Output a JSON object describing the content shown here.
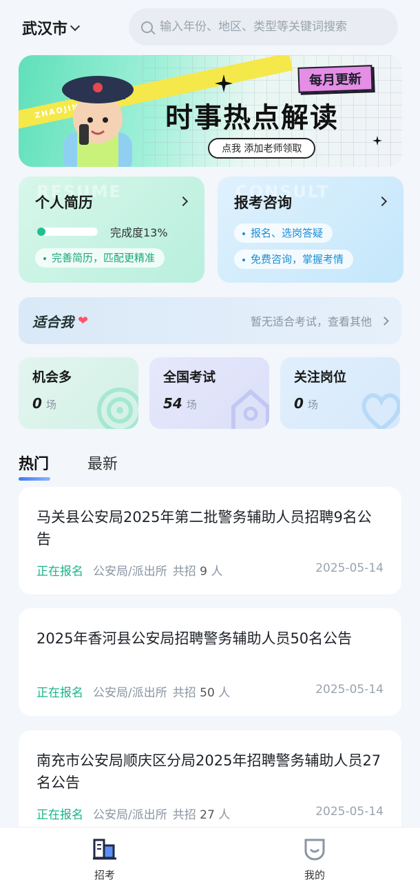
{
  "header": {
    "city": "武汉市",
    "search_placeholder": "输入年份、地区、类型等关键词搜索"
  },
  "banner": {
    "badge": "每月更新",
    "headline": "时事热点解读",
    "cta": "点我 添加老师领取",
    "stripe_text": "ZHAOJING KAO"
  },
  "resume_card": {
    "ghost": "RESUME",
    "title": "个人简历",
    "progress_label": "完成度13%",
    "progress": 0.13,
    "tip": "完善简历，匹配更精准"
  },
  "consult_card": {
    "ghost": "CONSULT",
    "title": "报考咨询",
    "tips": [
      "报名、选岗答疑",
      "免费咨询，掌握考情"
    ]
  },
  "suit": {
    "label": "适合我",
    "hint": "暂无适合考试，查看其他"
  },
  "stats": [
    {
      "name": "机会多",
      "value": "0",
      "unit": "场"
    },
    {
      "name": "全国考试",
      "value": "54",
      "unit": "场"
    },
    {
      "name": "关注岗位",
      "value": "0",
      "unit": "场"
    }
  ],
  "tabs": [
    "热门",
    "最新"
  ],
  "jobs": [
    {
      "title": "马关县公安局2025年第二批警务辅助人员招聘9名公告",
      "status": "正在报名",
      "category": "公安局/派出所",
      "count_prefix": "共招",
      "count": "9",
      "count_unit": "人",
      "date": "2025-05-14"
    },
    {
      "title": "2025年香河县公安局招聘警务辅助人员50名公告",
      "status": "正在报名",
      "category": "公安局/派出所",
      "count_prefix": "共招",
      "count": "50",
      "count_unit": "人",
      "date": "2025-05-14"
    },
    {
      "title": "南充市公安局顺庆区分局2025年招聘警务辅助人员27名公告",
      "status": "正在报名",
      "category": "公安局/派出所",
      "count_prefix": "共招",
      "count": "27",
      "count_unit": "人",
      "date": "2025-05-14"
    }
  ],
  "tabbar": [
    {
      "label": "招考",
      "icon": "building-icon"
    },
    {
      "label": "我的",
      "icon": "profile-icon"
    }
  ],
  "colors": {
    "accent_green": "#18b489",
    "accent_blue": "#1a8fd6",
    "heart": "#ff5468"
  }
}
